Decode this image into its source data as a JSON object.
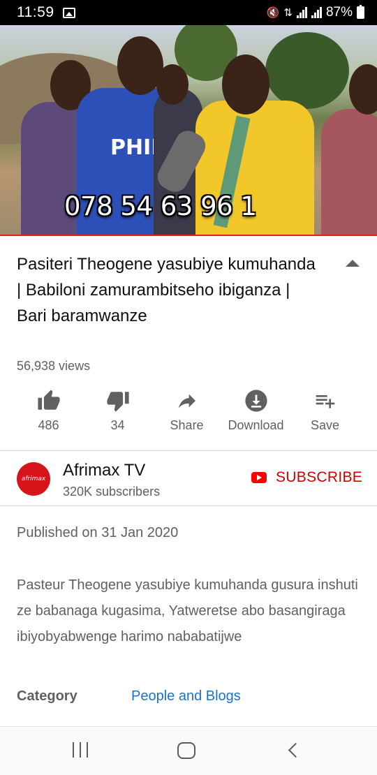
{
  "status_bar": {
    "time": "11:59",
    "battery": "87%"
  },
  "video": {
    "overlay_text": "078 54 63 96 1",
    "jersey_text": "PHIL"
  },
  "title": "Pasiteri Theogene yasubiye kumuhanda | Babiloni zamurambitseho ibiganza | Bari baramwanze",
  "views": "56,938 views",
  "actions": {
    "like_count": "486",
    "dislike_count": "34",
    "share_label": "Share",
    "download_label": "Download",
    "save_label": "Save"
  },
  "channel": {
    "avatar_text": "afrimax",
    "name": "Afrimax TV",
    "subscribers": "320K subscribers",
    "subscribe_label": "SUBSCRIBE"
  },
  "description": {
    "published": "Published on 31 Jan 2020",
    "text": "Pasteur Theogene yasubiye kumuhanda gusura inshuti ze babanaga kugasima, Yatweretse abo basangiraga ibiyobyabwenge harimo nababatijwe",
    "category_label": "Category",
    "category_value": "People and Blogs"
  },
  "colors": {
    "brand_red": "#cc0000",
    "link_blue": "#1a73c8",
    "secondary_text": "#606060"
  }
}
